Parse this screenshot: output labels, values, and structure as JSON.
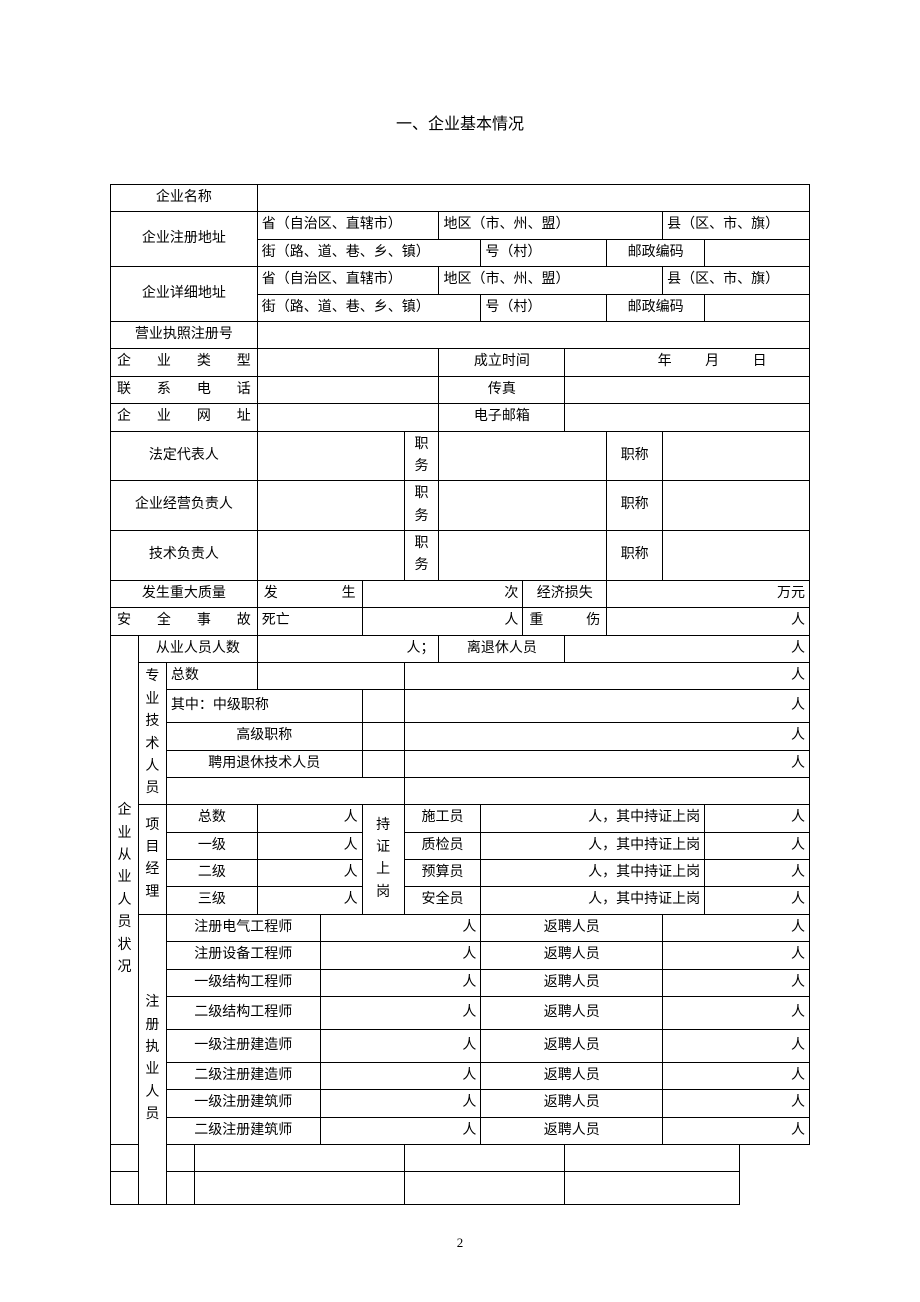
{
  "title": "一、企业基本情况",
  "labels": {
    "company_name": "企业名称",
    "reg_addr": "企业注册地址",
    "addr_province": "省（自治区、直辖市）",
    "addr_region": "地区（市、州、盟）",
    "addr_county": "县（区、市、旗）",
    "addr_street": "街（路、道、巷、乡、镇）",
    "addr_no": "号（村）",
    "postcode": "邮政编码",
    "detail_addr": "企业详细地址",
    "license_no": "营业执照注册号",
    "ent_type": "企业类型",
    "est_time": "成立时间",
    "year": "年",
    "month": "月",
    "day": "日",
    "phone": "联系电话",
    "fax": "传真",
    "website": "企业网址",
    "email": "电子邮箱",
    "legal_rep": "法定代表人",
    "biz_mgr": "企业经营负责人",
    "tech_mgr": "技术负责人",
    "duty": "职务",
    "title_rank": "职称",
    "major_quality": "发生重大质量",
    "occur": "发生",
    "times": "次",
    "econ_loss": "经济损失",
    "wan_yuan": "万元",
    "safety_accident": "安全事故",
    "death": "死亡",
    "person": "人",
    "serious_injury": "重伤",
    "staff_status": "企业从业人员状况",
    "employee_count_label": "从业人员人数",
    "employee_count_suffix": "人；",
    "retired_label": "离退休人员",
    "prof_tech": "专业技术人员",
    "total": "总数",
    "mid_title": "其中：中级职称",
    "senior_title": "高级职称",
    "hired_retired_tech": "聘用退休技术人员",
    "proj_mgr": "项目经理",
    "level1": "一级",
    "level2": "二级",
    "level3": "三级",
    "certified_on_duty": "持证上岗",
    "construction_staff": "施工员",
    "quality_staff": "质检员",
    "budget_staff": "预算员",
    "safety_staff": "安全员",
    "cert_suffix": "人，其中持证上岗",
    "reg_practitioners": "注册执业人员",
    "reg_elec_eng": "注册电气工程师",
    "reg_equip_eng": "注册设备工程师",
    "struct_eng_1": "一级结构工程师",
    "struct_eng_2": "二级结构工程师",
    "reg_builder_1": "一级注册建造师",
    "reg_builder_2": "二级注册建造师",
    "reg_architect_1": "一级注册建筑师",
    "reg_architect_2": "二级注册建筑师",
    "rehired": "返聘人员"
  },
  "page_number": "2"
}
